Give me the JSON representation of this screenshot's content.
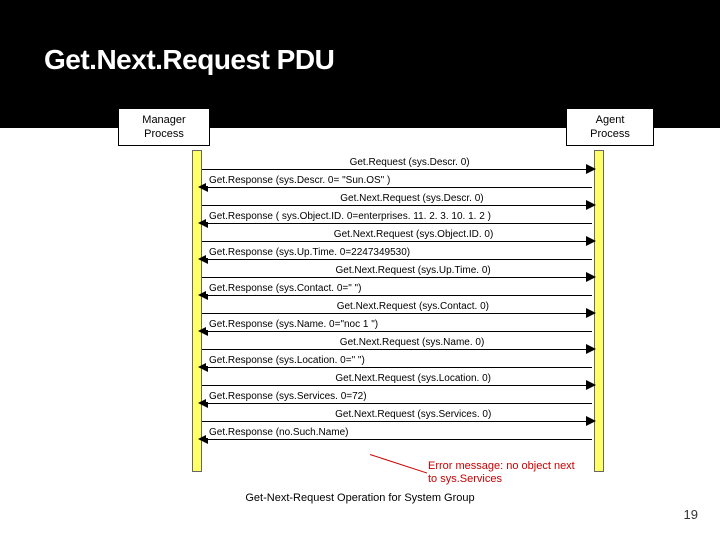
{
  "chart_data": {
    "type": "sequence-diagram",
    "title": "Get.Next.Request PDU",
    "participants": [
      {
        "name": "Manager Process"
      },
      {
        "name": "Agent Process"
      }
    ],
    "messages": [
      {
        "dir": "to-agent",
        "label": "Get.Request (sys.Descr. 0)"
      },
      {
        "dir": "to-mgr",
        "label": "Get.Response (sys.Descr. 0= \"Sun.OS\" )"
      },
      {
        "dir": "to-agent",
        "label": "Get.Next.Request (sys.Descr. 0)"
      },
      {
        "dir": "to-mgr",
        "label": "Get.Response ( sys.Object.ID. 0=enterprises. 11. 2. 3. 10. 1. 2 )"
      },
      {
        "dir": "to-agent",
        "label": "Get.Next.Request (sys.Object.ID. 0)"
      },
      {
        "dir": "to-mgr",
        "label": "Get.Response (sys.Up.Time. 0=2247349530)"
      },
      {
        "dir": "to-agent",
        "label": "Get.Next.Request (sys.Up.Time. 0)"
      },
      {
        "dir": "to-mgr",
        "label": "Get.Response (sys.Contact. 0=\" \")"
      },
      {
        "dir": "to-agent",
        "label": "Get.Next.Request (sys.Contact. 0)"
      },
      {
        "dir": "to-mgr",
        "label": "Get.Response (sys.Name. 0=\"noc 1 \")"
      },
      {
        "dir": "to-agent",
        "label": "Get.Next.Request (sys.Name. 0)"
      },
      {
        "dir": "to-mgr",
        "label": "Get.Response (sys.Location. 0=\" \")"
      },
      {
        "dir": "to-agent",
        "label": "Get.Next.Request (sys.Location. 0)"
      },
      {
        "dir": "to-mgr",
        "label": "Get.Response (sys.Services. 0=72)"
      },
      {
        "dir": "to-agent",
        "label": "Get.Next.Request (sys.Services. 0)"
      },
      {
        "dir": "to-mgr",
        "label": "Get.Response (no.Such.Name)"
      }
    ],
    "annotation_text": "Error message: no object next to sys.Services",
    "caption": "Get-Next-Request Operation for System Group"
  },
  "header": {
    "title": "Get.Next.Request PDU"
  },
  "boxes": {
    "manager_line1": "Manager",
    "manager_line2": "Process",
    "agent_line1": "Agent",
    "agent_line2": "Process"
  },
  "callout": {
    "line1": "Error message: no object next",
    "line2": "to sys.Services"
  },
  "caption": "Get-Next-Request Operation for System Group",
  "slidenum": "19"
}
